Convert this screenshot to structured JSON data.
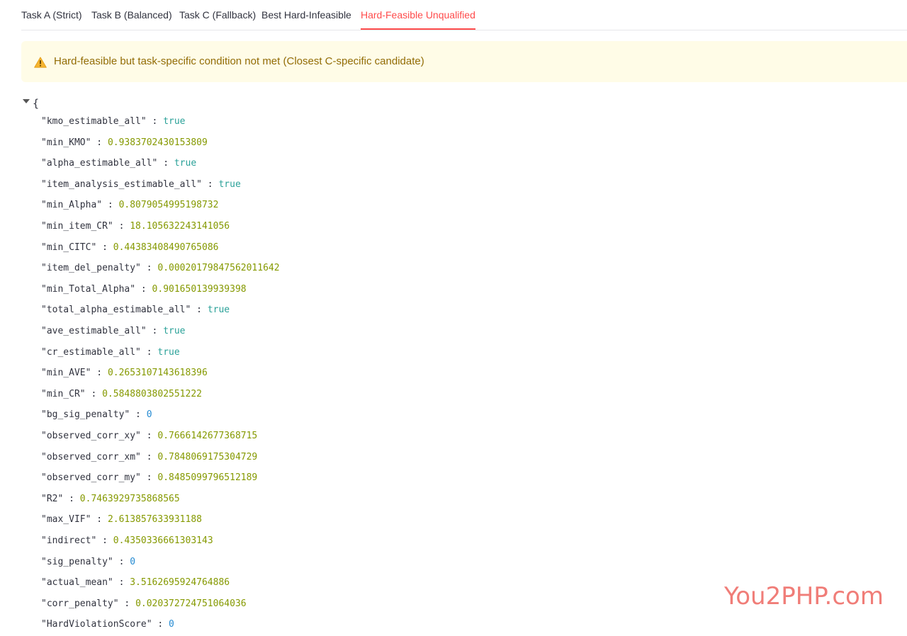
{
  "tabs": [
    {
      "label": "Task A (Strict)"
    },
    {
      "label": "Task B (Balanced)"
    },
    {
      "label": "Task C (Fallback)"
    },
    {
      "label": "Best Hard-Infeasible"
    },
    {
      "label": "Hard-Feasible Unqualified"
    }
  ],
  "active_tab": "Hard-Feasible Unqualified",
  "alert": {
    "icon": "warning-triangle-icon",
    "text": "Hard-feasible but task-specific condition not met (Closest C-specific candidate)"
  },
  "json_viewer": {
    "open_brace": "{",
    "rows": [
      {
        "key": "\"kmo_estimable_all\"",
        "value": "true",
        "type": "bool"
      },
      {
        "key": "\"min_KMO\"",
        "value": "0.9383702430153809",
        "type": "num"
      },
      {
        "key": "\"alpha_estimable_all\"",
        "value": "true",
        "type": "bool"
      },
      {
        "key": "\"item_analysis_estimable_all\"",
        "value": "true",
        "type": "bool"
      },
      {
        "key": "\"min_Alpha\"",
        "value": "0.8079054995198732",
        "type": "num"
      },
      {
        "key": "\"min_item_CR\"",
        "value": "18.105632243141056",
        "type": "num"
      },
      {
        "key": "\"min_CITC\"",
        "value": "0.44383408490765086",
        "type": "num"
      },
      {
        "key": "\"item_del_penalty\"",
        "value": "0.00020179847562011642",
        "type": "num"
      },
      {
        "key": "\"min_Total_Alpha\"",
        "value": "0.901650139939398",
        "type": "num"
      },
      {
        "key": "\"total_alpha_estimable_all\"",
        "value": "true",
        "type": "bool"
      },
      {
        "key": "\"ave_estimable_all\"",
        "value": "true",
        "type": "bool"
      },
      {
        "key": "\"cr_estimable_all\"",
        "value": "true",
        "type": "bool"
      },
      {
        "key": "\"min_AVE\"",
        "value": "0.2653107143618396",
        "type": "num"
      },
      {
        "key": "\"min_CR\"",
        "value": "0.5848803802551222",
        "type": "num"
      },
      {
        "key": "\"bg_sig_penalty\"",
        "value": "0",
        "type": "int"
      },
      {
        "key": "\"observed_corr_xy\"",
        "value": "0.7666142677368715",
        "type": "num"
      },
      {
        "key": "\"observed_corr_xm\"",
        "value": "0.7848069175304729",
        "type": "num"
      },
      {
        "key": "\"observed_corr_my\"",
        "value": "0.8485099796512189",
        "type": "num"
      },
      {
        "key": "\"R2\"",
        "value": "0.7463929735868565",
        "type": "num"
      },
      {
        "key": "\"max_VIF\"",
        "value": "2.613857633931188",
        "type": "num"
      },
      {
        "key": "\"indirect\"",
        "value": "0.4350336661303143",
        "type": "num"
      },
      {
        "key": "\"sig_penalty\"",
        "value": "0",
        "type": "int"
      },
      {
        "key": "\"actual_mean\"",
        "value": "3.5162695924764886",
        "type": "num"
      },
      {
        "key": "\"corr_penalty\"",
        "value": "0.020372724751064036",
        "type": "num"
      },
      {
        "key": "\"HardViolationScore\"",
        "value": "0",
        "type": "int"
      }
    ]
  },
  "watermark": "You2PHP.com",
  "colors": {
    "accent": "#ff4b4b",
    "alert_bg": "#fffce7",
    "alert_text": "#926c05",
    "bool": "#2aa198",
    "number": "#859900",
    "integer": "#268bd2"
  }
}
